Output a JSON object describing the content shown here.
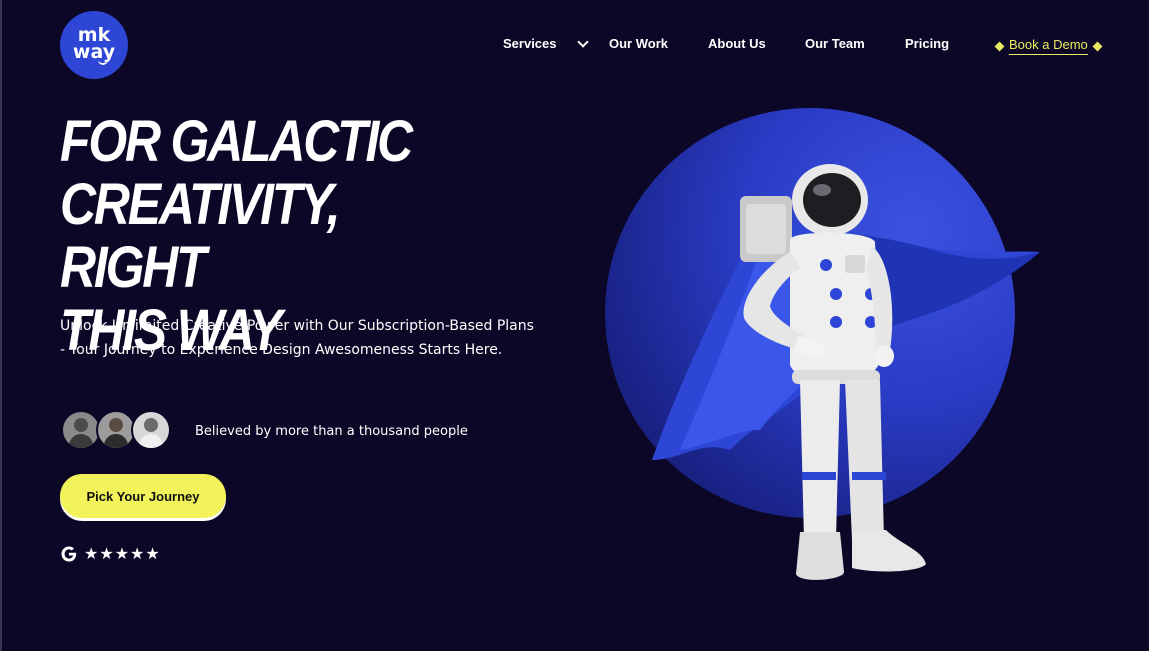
{
  "header": {
    "logo": {
      "line1": "mk",
      "line2": "way"
    },
    "nav": [
      {
        "label": "Services",
        "has_dropdown": true
      },
      {
        "label": "Our Work"
      },
      {
        "label": "About Us"
      },
      {
        "label": "Our Team"
      },
      {
        "label": "Pricing"
      }
    ],
    "cta_label": "Book a Demo"
  },
  "hero": {
    "title": "FOR GALACTIC CREATIVITY, RIGHT THIS WAY",
    "title_lines": [
      "FOR GALACTIC",
      "CREATIVITY, RIGHT",
      "THIS WAY"
    ],
    "subtitle": "Unlock Unlimited Creative Power with Our Subscription-Based Plans - Your Journey to Experience Design Awesomeness Starts Here.",
    "social_proof": "Believed by more than a thousand people",
    "button_label": "Pick Your Journey",
    "rating_stars": "★★★★★",
    "rating_value": 5
  },
  "colors": {
    "background": "#0c0726",
    "accent_yellow": "#f2f25a",
    "brand_blue": "#2d46d6"
  },
  "icons": [
    "chevron-down-icon",
    "diamond-icon",
    "google-icon",
    "star-icon"
  ]
}
